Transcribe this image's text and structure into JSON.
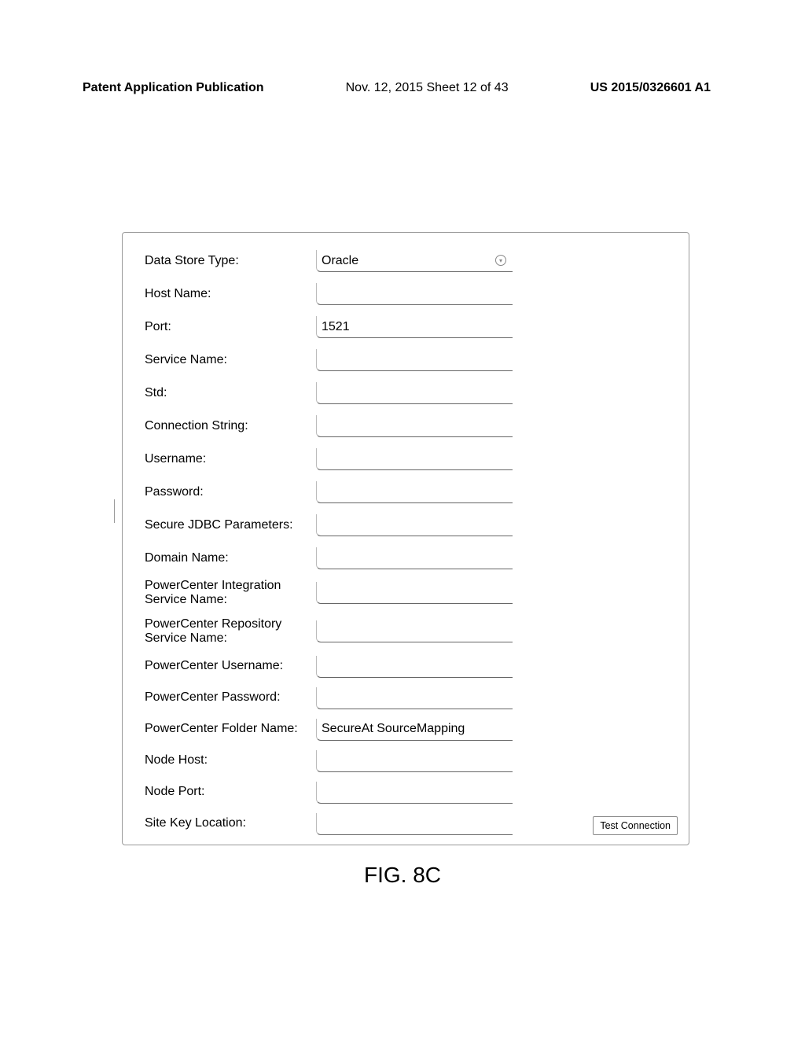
{
  "header": {
    "left": "Patent Application Publication",
    "mid": "Nov. 12, 2015  Sheet 12 of 43",
    "right": "US 2015/0326601 A1"
  },
  "form": {
    "dataStoreType": {
      "label": "Data Store Type:",
      "value": "Oracle"
    },
    "hostName": {
      "label": "Host Name:",
      "value": ""
    },
    "port": {
      "label": "Port:",
      "value": "1521"
    },
    "serviceName": {
      "label": "Service Name:",
      "value": ""
    },
    "std": {
      "label": "Std:",
      "value": ""
    },
    "connectionString": {
      "label": "Connection String:",
      "value": ""
    },
    "username": {
      "label": "Username:",
      "value": ""
    },
    "password": {
      "label": "Password:",
      "value": ""
    },
    "secureJdbc": {
      "label": "Secure JDBC Parameters:",
      "value": ""
    },
    "domainName": {
      "label": "Domain Name:",
      "value": ""
    },
    "pcIntegration": {
      "label": "PowerCenter Integration Service Name:",
      "value": ""
    },
    "pcRepository": {
      "label": "PowerCenter Repository Service Name:",
      "value": ""
    },
    "pcUsername": {
      "label": "PowerCenter Username:",
      "value": ""
    },
    "pcPassword": {
      "label": "PowerCenter Password:",
      "value": ""
    },
    "pcFolder": {
      "label": "PowerCenter Folder Name:",
      "value": "SecureAt SourceMapping"
    },
    "nodeHost": {
      "label": "Node Host:",
      "value": ""
    },
    "nodePort": {
      "label": "Node Port:",
      "value": ""
    },
    "siteKey": {
      "label": "Site Key Location:",
      "value": ""
    },
    "testConnection": "Test Connection"
  },
  "caption": "FIG. 8C"
}
